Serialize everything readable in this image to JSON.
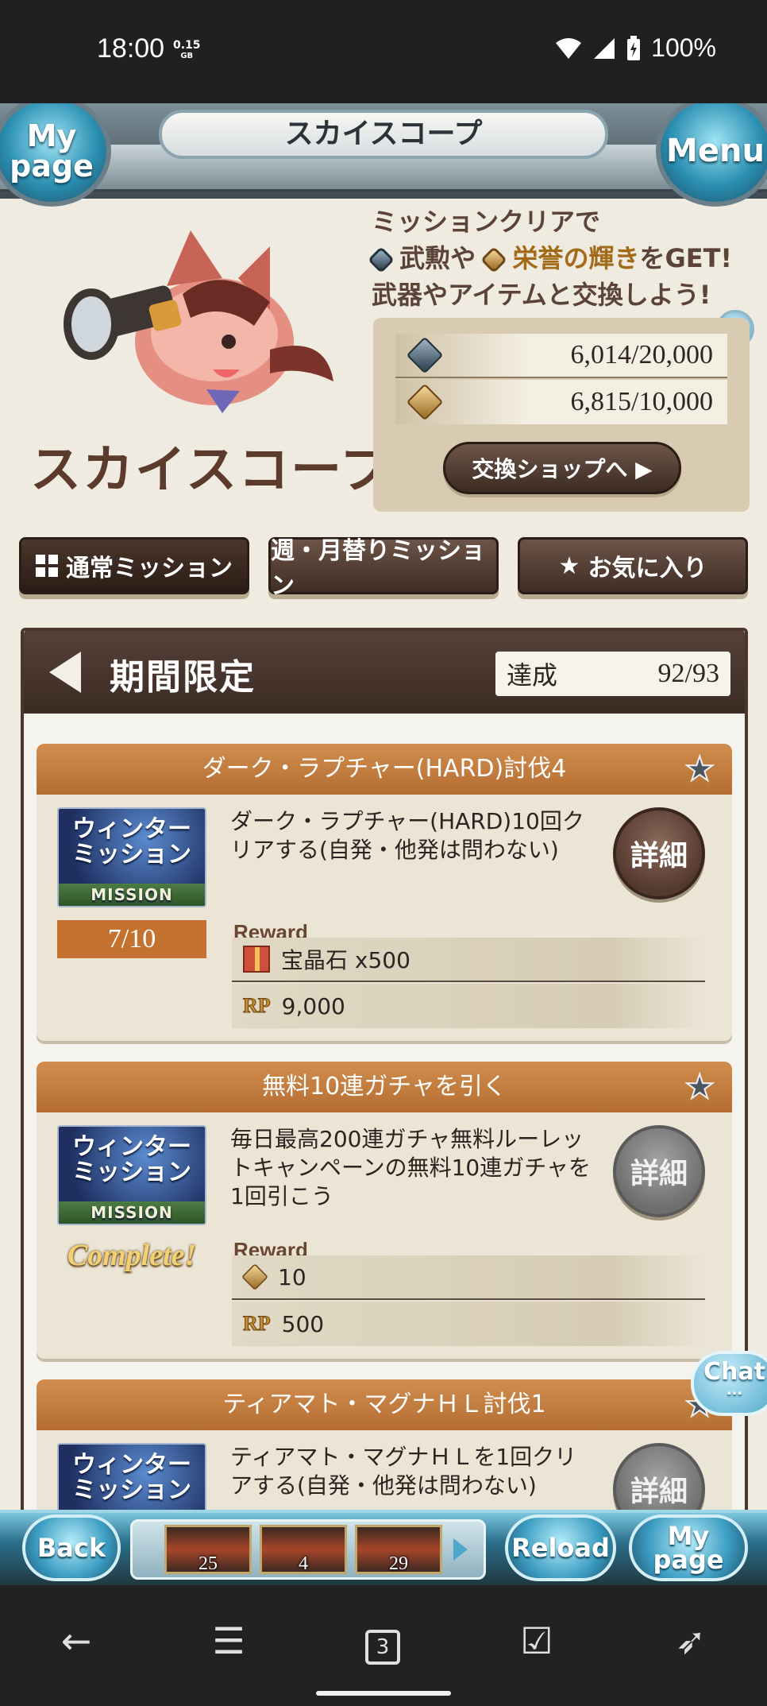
{
  "status_bar": {
    "time": "18:00",
    "data_top": "0.15",
    "data_unit": "GB",
    "battery": "100%"
  },
  "header": {
    "title": "スカイスコープ",
    "left_orb": "My page",
    "right_orb": "Menu"
  },
  "intro": {
    "logo_text": "スカイスコープ",
    "line1": "ミッションクリアで",
    "line2_a": "武勲",
    "line2_b": "や",
    "line2_c": "栄誉の輝き",
    "line2_d": "をGET!",
    "line3": "武器やアイテムと交換しよう!"
  },
  "currency": {
    "valor": "6,014/20,000",
    "glory": "6,815/10,000",
    "shop_button": "交換ショップへ ▶",
    "info": "i"
  },
  "tabs": [
    {
      "label": "通常ミッション"
    },
    {
      "label": "週・月替りミッション"
    },
    {
      "label": "お気に入り"
    }
  ],
  "list": {
    "title": "期間限定",
    "achieve_label": "達成",
    "achieve_value": "92/93",
    "missions": [
      {
        "title": "ダーク・ラプチャー(HARD)討伐4",
        "image_line1": "ウィンター",
        "image_line2": "ミッション",
        "image_tag": "MISSION",
        "progress": "7/10",
        "description": "ダーク・ラプチャー(HARD)10回クリアする(自発・他発は問わない)",
        "detail": "詳細",
        "reward_label": "Reward",
        "reward1": "宝晶石 x500",
        "reward2_prefix": "RP",
        "reward2": "9,000"
      },
      {
        "title": "無料10連ガチャを引く",
        "image_line1": "ウィンター",
        "image_line2": "ミッション",
        "image_tag": "MISSION",
        "status": "Complete!",
        "description": "毎日最高200連ガチャ無料ルーレットキャンペーンの無料10連ガチャを1回引こう",
        "detail": "詳細",
        "reward_label": "Reward",
        "reward1": "10",
        "reward2_prefix": "RP",
        "reward2": "500"
      },
      {
        "title": "ティアマト・マグナＨＬ討伐1",
        "image_line1": "ウィンター",
        "image_line2": "ミッション",
        "description": "ティアマト・マグナＨＬを1回クリアする(自発・他発は問わない)",
        "detail": "詳細"
      }
    ]
  },
  "chat": {
    "label": "Chat",
    "dots": "..."
  },
  "game_bar": {
    "back": "Back",
    "reload": "Reload",
    "mypage": "My page",
    "quick_counts": [
      "25",
      "4",
      "29"
    ]
  },
  "browser_nav": {
    "tabs_count": "3"
  }
}
